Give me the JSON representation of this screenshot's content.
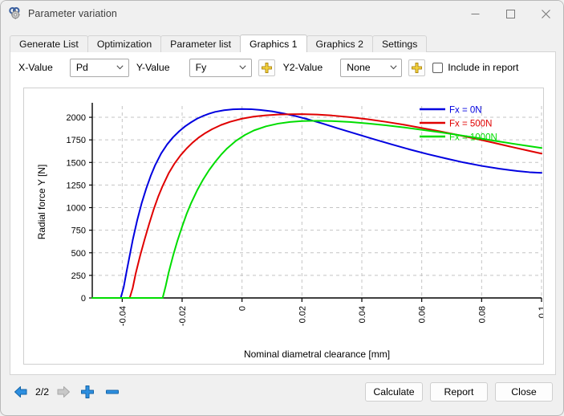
{
  "window": {
    "title": "Parameter variation",
    "app_icon": "gear-icon",
    "minimize_label": "─",
    "maximize_label": "□",
    "close_label": "✕"
  },
  "tabs": [
    {
      "label": "Generate List",
      "active": false
    },
    {
      "label": "Optimization",
      "active": false
    },
    {
      "label": "Parameter list",
      "active": false
    },
    {
      "label": "Graphics 1",
      "active": true
    },
    {
      "label": "Graphics 2",
      "active": false
    },
    {
      "label": "Settings",
      "active": false
    }
  ],
  "toolbar": {
    "x_value_label": "X-Value",
    "x_value_selected": "Pd",
    "y_value_label": "Y-Value",
    "y_value_selected": "Fy",
    "y_add_icon": "plus-icon",
    "y2_value_label": "Y2-Value",
    "y2_value_selected": "None",
    "y2_add_icon": "plus-icon",
    "include_in_report_label": "Include in report",
    "include_in_report_checked": false,
    "dropdown_arrow": "chevron-down-icon"
  },
  "bottom": {
    "prev_icon": "arrow-left-icon",
    "next_icon": "arrow-right-icon",
    "add_icon": "plus-icon",
    "remove_icon": "minus-icon",
    "page_indicator": "2/2",
    "calculate_label": "Calculate",
    "report_label": "Report",
    "close_label": "Close"
  },
  "chart_data": {
    "type": "line",
    "title": "",
    "xlabel": "Nominal diametral clearance [mm]",
    "ylabel": "Radial force Y [N]",
    "xlim": [
      -0.05,
      0.1
    ],
    "ylim": [
      0,
      2125
    ],
    "xticks": [
      -0.04,
      -0.02,
      0,
      0.02,
      0.04,
      0.06,
      0.08,
      0.1
    ],
    "xticklabels": [
      "-0.04",
      "-0.02",
      "0",
      "0.02",
      "0.04",
      "0.06",
      "0.08",
      "0.1"
    ],
    "yticks": [
      0,
      250,
      500,
      750,
      1000,
      1250,
      1500,
      1750,
      2000
    ],
    "yticklabels": [
      "0",
      "250",
      "500",
      "750",
      "1000",
      "1250",
      "1500",
      "1750",
      "2000"
    ],
    "grid": true,
    "grid_style": "dashed",
    "grid_color": "#c4c4c4",
    "legend_position": "top-right",
    "series": [
      {
        "name": "Fx = 0N",
        "color": "#0000e0",
        "x": [
          -0.05,
          -0.045,
          -0.041,
          -0.0405,
          -0.0395,
          -0.0385,
          -0.0375,
          -0.0365,
          -0.035,
          -0.0335,
          -0.032,
          -0.0305,
          -0.029,
          -0.027,
          -0.025,
          -0.023,
          -0.021,
          -0.019,
          -0.017,
          -0.015,
          -0.013,
          -0.011,
          -0.009,
          -0.006,
          -0.003,
          0.0,
          0.003,
          0.006,
          0.01,
          0.014,
          0.018,
          0.022,
          0.027,
          0.032,
          0.038,
          0.044,
          0.05,
          0.056,
          0.062,
          0.068,
          0.074,
          0.08,
          0.086,
          0.092,
          0.096,
          0.1
        ],
        "y": [
          0,
          0,
          0,
          0,
          120,
          300,
          470,
          640,
          860,
          1050,
          1210,
          1350,
          1470,
          1600,
          1700,
          1780,
          1845,
          1900,
          1945,
          1985,
          2015,
          2040,
          2060,
          2078,
          2088,
          2092,
          2090,
          2082,
          2066,
          2042,
          2012,
          1978,
          1930,
          1878,
          1818,
          1758,
          1700,
          1644,
          1592,
          1545,
          1500,
          1462,
          1430,
          1405,
          1392,
          1385
        ]
      },
      {
        "name": "Fx = 500N",
        "color": "#e00000",
        "x": [
          -0.05,
          -0.045,
          -0.039,
          -0.0375,
          -0.0365,
          -0.0355,
          -0.034,
          -0.0325,
          -0.031,
          -0.0295,
          -0.028,
          -0.0265,
          -0.0245,
          -0.0225,
          -0.0205,
          -0.0185,
          -0.0165,
          -0.0145,
          -0.0125,
          -0.01,
          -0.007,
          -0.004,
          0.0,
          0.004,
          0.008,
          0.012,
          0.016,
          0.02,
          0.025,
          0.03,
          0.036,
          0.042,
          0.048,
          0.054,
          0.06,
          0.066,
          0.072,
          0.078,
          0.084,
          0.09,
          0.095,
          0.1
        ],
        "y": [
          0,
          0,
          0,
          0,
          110,
          270,
          470,
          650,
          820,
          980,
          1120,
          1240,
          1380,
          1490,
          1580,
          1655,
          1720,
          1775,
          1820,
          1868,
          1915,
          1950,
          1985,
          2008,
          2022,
          2030,
          2034,
          2035,
          2030,
          2020,
          2002,
          1978,
          1950,
          1918,
          1882,
          1845,
          1805,
          1762,
          1718,
          1672,
          1635,
          1598
        ]
      },
      {
        "name": "Fx = 1000N",
        "color": "#00dd00",
        "x": [
          -0.05,
          -0.04,
          -0.03,
          -0.0265,
          -0.0255,
          -0.0245,
          -0.023,
          -0.0215,
          -0.02,
          -0.0185,
          -0.017,
          -0.015,
          -0.013,
          -0.011,
          -0.009,
          -0.007,
          -0.005,
          -0.002,
          0.001,
          0.004,
          0.008,
          0.012,
          0.016,
          0.02,
          0.025,
          0.03,
          0.036,
          0.042,
          0.048,
          0.054,
          0.06,
          0.066,
          0.072,
          0.078,
          0.084,
          0.09,
          0.095,
          0.1
        ],
        "y": [
          0,
          0,
          0,
          0,
          130,
          280,
          470,
          640,
          790,
          930,
          1050,
          1190,
          1310,
          1415,
          1505,
          1585,
          1655,
          1740,
          1805,
          1855,
          1900,
          1930,
          1948,
          1958,
          1962,
          1958,
          1948,
          1932,
          1912,
          1888,
          1862,
          1835,
          1805,
          1775,
          1742,
          1710,
          1685,
          1660
        ]
      }
    ]
  }
}
